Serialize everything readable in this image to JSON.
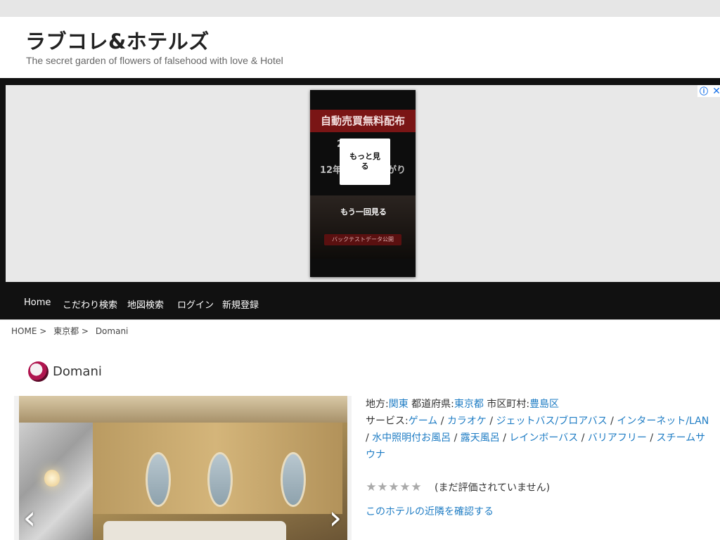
{
  "site": {
    "title": "ラブコレ&ホテルズ",
    "tagline": "The secret garden of flowers of falsehood with love & Hotel"
  },
  "ad": {
    "headline": "自動売買無料配布",
    "line1": "2年…　…倍",
    "line2": "12年間…　…上がり",
    "more_label": "もっと見る",
    "replay_label": "もう一回見る",
    "cta": "バックテストデータ公開",
    "info_icon": "ⓘ",
    "close_icon": "✕"
  },
  "nav": {
    "items": [
      {
        "label": "Home"
      },
      {
        "label": "こだわり検索"
      },
      {
        "label": "地図検索"
      },
      {
        "label": "ログイン"
      },
      {
        "label": "新規登録"
      }
    ]
  },
  "breadcrumb": {
    "items": [
      "HOME >",
      "東京都 >",
      "Domani"
    ]
  },
  "hotel": {
    "name": "Domani",
    "region_label": "地方:",
    "region": "関東",
    "prefecture_label": "都道府県:",
    "prefecture": "東京都",
    "city_label": "市区町村:",
    "city": "豊島区",
    "services_label": "サービス:",
    "services": [
      "ゲーム",
      "カラオケ",
      "ジェットバス/ブロアバス",
      "インターネット/LAN",
      "水中照明付お風呂",
      "露天風呂",
      "レインボーバス",
      "バリアフリー",
      "スチームサウナ"
    ],
    "separator": " / ",
    "rating": 0,
    "rating_max": 5,
    "rating_text": "(まだ評価されていません)",
    "nearby_link": "このホテルの近隣を確認する"
  },
  "gallery": {
    "prev_icon": "‹",
    "next_icon": "›"
  }
}
